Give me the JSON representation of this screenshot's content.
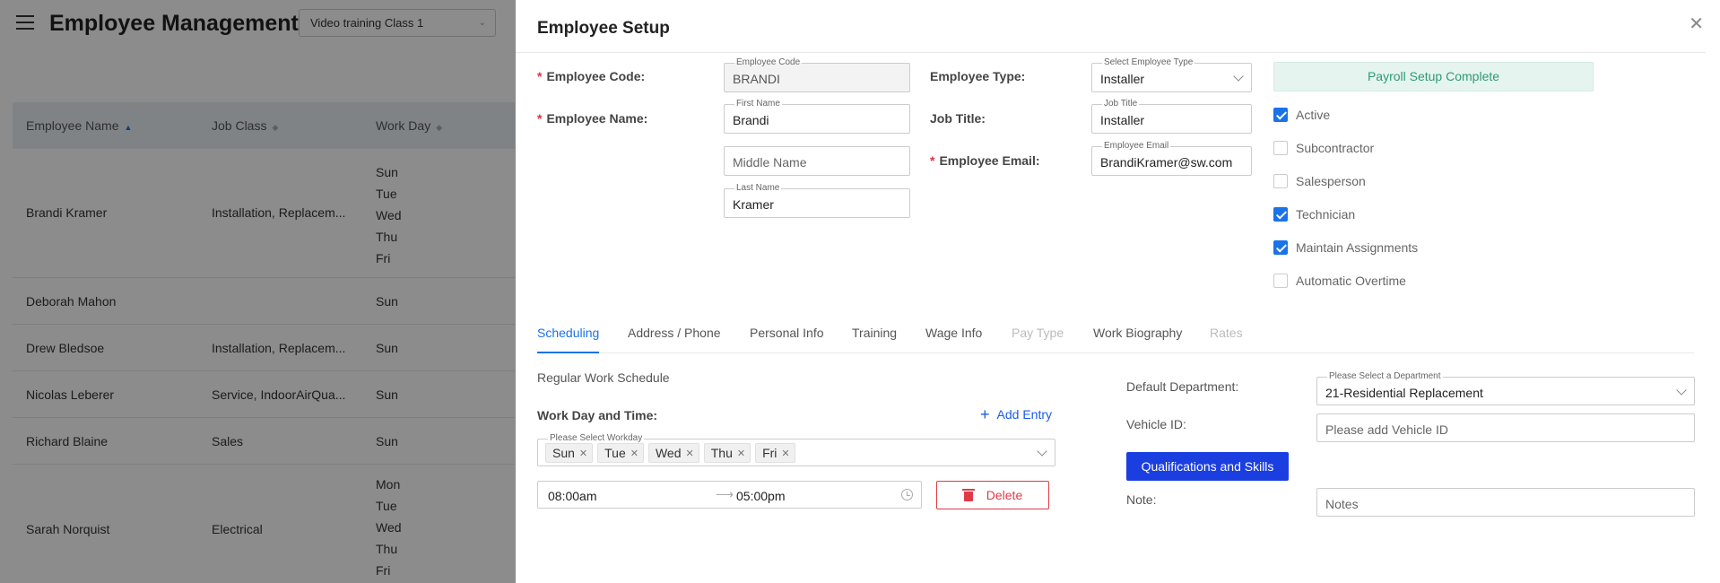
{
  "bg": {
    "title": "Employee Management",
    "class_select": "Video training Class 1",
    "columns": [
      "Employee Name",
      "Job Class",
      "Work Day"
    ],
    "rows": [
      {
        "name": "Brandi Kramer",
        "job": "Installation, Replacem...",
        "days": [
          "Sun",
          "Tue",
          "Wed",
          "Thu",
          "Fri"
        ]
      },
      {
        "name": "Deborah Mahon",
        "job": "",
        "days": [
          "Sun"
        ]
      },
      {
        "name": "Drew Bledsoe",
        "job": "Installation, Replacem...",
        "days": [
          "Sun"
        ]
      },
      {
        "name": "Nicolas Leberer",
        "job": "Service, IndoorAirQua...",
        "days": [
          "Sun"
        ]
      },
      {
        "name": "Richard Blaine",
        "job": "Sales",
        "days": [
          "Sun"
        ]
      },
      {
        "name": "Sarah Norquist",
        "job": "Electrical",
        "days": [
          "Mon",
          "Tue",
          "Wed",
          "Thu",
          "Fri"
        ]
      }
    ]
  },
  "drawer": {
    "title": "Employee Setup",
    "labels": {
      "employee_code": "Employee Code:",
      "employee_name": "Employee Name:",
      "employee_type": "Employee Type:",
      "job_title": "Job Title:",
      "employee_email": "Employee Email:"
    },
    "fields": {
      "code": {
        "float": "Employee Code",
        "value": "BRANDI"
      },
      "first_name": {
        "float": "First Name",
        "value": "Brandi"
      },
      "middle_name": {
        "placeholder": "Middle Name"
      },
      "last_name": {
        "float": "Last Name",
        "value": "Kramer"
      },
      "employee_type": {
        "float": "Select Employee Type",
        "value": "Installer"
      },
      "job_title": {
        "float": "Job Title",
        "value": "Installer"
      },
      "email": {
        "float": "Employee Email",
        "value": "BrandiKramer@sw.com"
      }
    },
    "payroll_button": "Payroll Setup Complete",
    "checkboxes": [
      {
        "label": "Active",
        "checked": true
      },
      {
        "label": "Subcontractor",
        "checked": false
      },
      {
        "label": "Salesperson",
        "checked": false
      },
      {
        "label": "Technician",
        "checked": true
      },
      {
        "label": "Maintain Assignments",
        "checked": true
      },
      {
        "label": "Automatic Overtime",
        "checked": false
      }
    ],
    "tabs": [
      {
        "label": "Scheduling",
        "state": "active"
      },
      {
        "label": "Address / Phone",
        "state": "normal"
      },
      {
        "label": "Personal Info",
        "state": "normal"
      },
      {
        "label": "Training",
        "state": "normal"
      },
      {
        "label": "Wage Info",
        "state": "normal"
      },
      {
        "label": "Pay Type",
        "state": "disabled"
      },
      {
        "label": "Work Biography",
        "state": "normal"
      },
      {
        "label": "Rates",
        "state": "disabled"
      }
    ],
    "scheduling": {
      "regular_label": "Regular Work Schedule",
      "work_day_time_label": "Work Day and Time:",
      "add_entry": "Add Entry",
      "workday_float": "Please Select Workday",
      "workdays": [
        "Sun",
        "Tue",
        "Wed",
        "Thu",
        "Fri"
      ],
      "start_time": "08:00am",
      "end_time": "05:00pm",
      "delete": "Delete",
      "default_department_label": "Default Department:",
      "department_float": "Please Select a Department",
      "department_value": "21-Residential Replacement",
      "vehicle_label": "Vehicle ID:",
      "vehicle_placeholder": "Please add Vehicle ID",
      "qualifications_button": "Qualifications and Skills",
      "note_label": "Note:",
      "notes_placeholder": "Notes"
    }
  },
  "colors": {
    "accent": "#1a73e8",
    "primary_button": "#1b3ee0",
    "danger": "#e03a48",
    "success_bg": "#e6f4ef",
    "success_text": "#2f9a74"
  }
}
